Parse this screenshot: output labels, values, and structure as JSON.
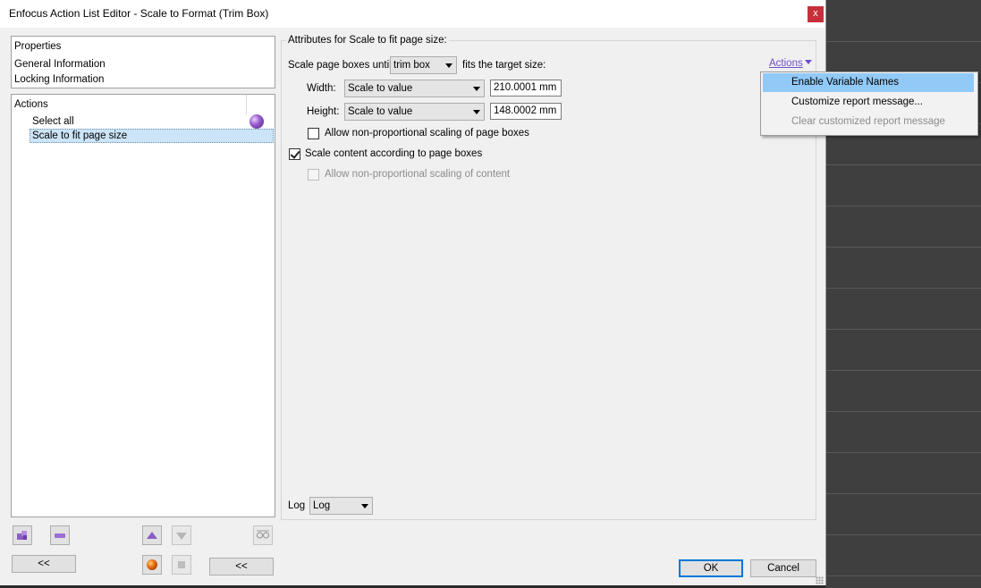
{
  "window": {
    "title": "Enfocus Action List Editor - Scale to Format (Trim Box)",
    "close_glyph": "x"
  },
  "properties_panel": {
    "header": "Properties",
    "items": [
      "General Information",
      "Locking Information"
    ]
  },
  "actions_panel": {
    "header": "Actions",
    "items": [
      "Select all",
      "Scale to fit page size"
    ],
    "selected_index": 1
  },
  "left_buttons": {
    "collapse_left": "<<",
    "collapse_right": "<<"
  },
  "attributes": {
    "group_title": "Attributes for Scale to fit page size:",
    "scale_prefix": "Scale page boxes until",
    "box_value": "trim box",
    "scale_suffix": "fits the target size:",
    "width_label": "Width:",
    "width_mode": "Scale to value",
    "width_value": "210.0001 mm",
    "height_label": "Height:",
    "height_mode": "Scale to value",
    "height_value": "148.0002 mm",
    "nonprop_boxes_label": "Allow non-proportional scaling of page boxes",
    "nonprop_boxes_checked": false,
    "scale_content_label": "Scale content according to page boxes",
    "scale_content_checked": true,
    "nonprop_content_label": "Allow non-proportional scaling of content",
    "nonprop_content_checked": false,
    "log_label": "Log",
    "log_value": "Log"
  },
  "actions_menu": {
    "link_label": "Actions",
    "items": [
      {
        "label": "Enable Variable Names",
        "highlighted": true,
        "enabled": true
      },
      {
        "label": "Customize report message...",
        "highlighted": false,
        "enabled": true
      },
      {
        "label": "Clear customized report message",
        "highlighted": false,
        "enabled": false
      }
    ]
  },
  "footer": {
    "ok_label": "OK",
    "cancel_label": "Cancel"
  },
  "colors": {
    "selection": "#cce4f7",
    "menu_highlight": "#91c9f7",
    "link": "#6e4fc9",
    "close": "#c7303a"
  }
}
